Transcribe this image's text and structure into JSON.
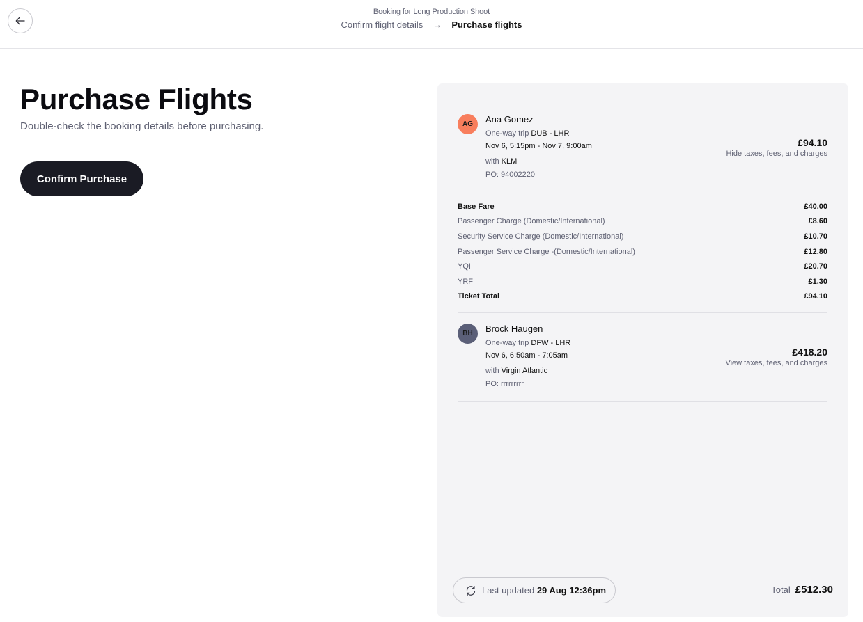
{
  "header": {
    "subtitle": "Booking for Long Production Shoot",
    "breadcrumb_prev": "Confirm flight details",
    "breadcrumb_arrow": "→",
    "breadcrumb_current": "Purchase flights"
  },
  "main": {
    "title": "Purchase Flights",
    "subtitle": "Double-check the booking details before purchasing.",
    "confirm_label": "Confirm Purchase"
  },
  "passengers": [
    {
      "initials": "AG",
      "avatar_color": "#f87e5d",
      "name": "Ana Gomez",
      "trip_type": "One-way trip",
      "route": "DUB - LHR",
      "times": "Nov 6, 5:15pm - Nov 7, 9:00am",
      "with_label": "with",
      "airline": "KLM",
      "po": "PO: 94002220",
      "price": "£94.10",
      "taxes_link": "Hide taxes, fees, and charges",
      "fees": [
        {
          "label": "Base Fare",
          "value": "£40.00"
        },
        {
          "label": "Passenger Charge (Domestic/International)",
          "value": "£8.60"
        },
        {
          "label": "Security Service Charge (Domestic/International)",
          "value": "£10.70"
        },
        {
          "label": "Passenger Service Charge -(Domestic/International)",
          "value": "£12.80"
        },
        {
          "label": "YQI",
          "value": "£20.70"
        },
        {
          "label": "YRF",
          "value": "£1.30"
        },
        {
          "label": "Ticket Total",
          "value": "£94.10"
        }
      ]
    },
    {
      "initials": "BH",
      "avatar_color": "#5b5f78",
      "name": "Brock Haugen",
      "trip_type": "One-way trip",
      "route": "DFW - LHR",
      "times": "Nov 6, 6:50am - 7:05am",
      "with_label": "with",
      "airline": "Virgin Atlantic",
      "po": "PO: rrrrrrrrr",
      "price": "£418.20",
      "taxes_link": "View taxes, fees, and charges"
    }
  ],
  "footer": {
    "updated_label": "Last updated",
    "updated_value": "29 Aug 12:36pm",
    "total_label": "Total",
    "total_value": "£512.30"
  }
}
